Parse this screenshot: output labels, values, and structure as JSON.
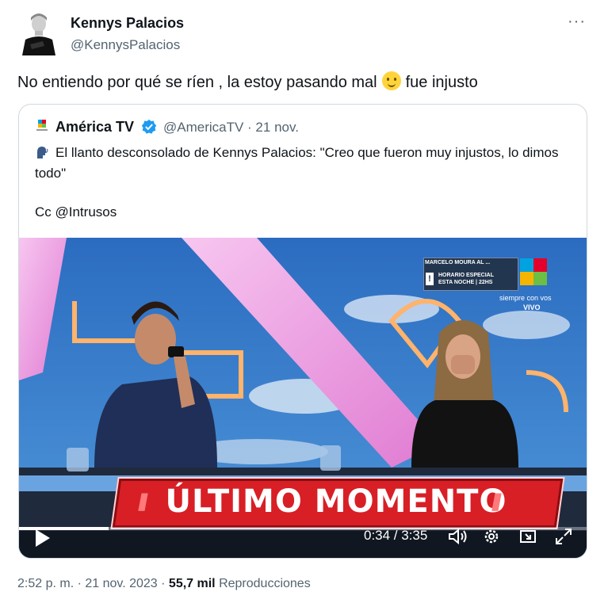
{
  "author": {
    "name": "Kennys Palacios",
    "handle": "@KennysPalacios"
  },
  "tweet": {
    "text_before": "No entiendo por qué se ríen , la estoy pasando mal",
    "emoji": "smiling-face-with-tear-emoji",
    "text_after": "fue injusto"
  },
  "quote": {
    "name": "América TV",
    "handle_date": "@AmericaTV · 21 nov.",
    "text": "El llanto desconsolado de Kennys Palacios: \"Creo que fueron muy injustos, lo dimos todo\"",
    "cc": "Cc @Intrusos"
  },
  "video": {
    "banner": "ÚLTIMO MOMENTO",
    "banner_slashes": "///",
    "sign_line1": "MARCELO MOURA AL ...",
    "sign_line2": "HORARIO ESPECIAL",
    "sign_line3": "ESTA NOCHE | 22HS",
    "tagline": "siempre con vos",
    "live": "VIVO",
    "time": "0:34 / 3:35",
    "progress": 0.158
  },
  "meta": {
    "time_date": "2:52 p. m. · 21 nov. 2023 · ",
    "views": "55,7 mil",
    "views_label": "Reproducciones"
  },
  "colors": {
    "verified": "#1d9bf0",
    "banner": "#d81f26",
    "muted": "#536471"
  }
}
